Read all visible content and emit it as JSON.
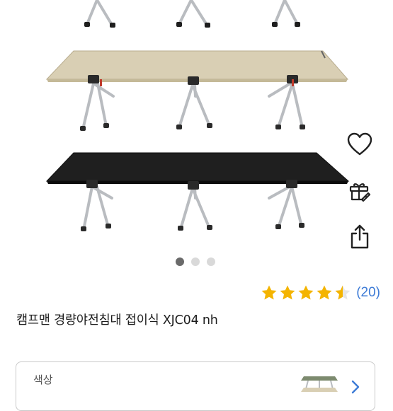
{
  "gallery": {
    "slide_count": 3,
    "active_slide": 1,
    "cot_colors": {
      "tan": "#d9cfb4",
      "black": "#1f1f1f",
      "frame": "#b9bcc0"
    }
  },
  "actions": {
    "wishlist_icon": "heart-icon",
    "gift_icon": "gift-icon",
    "share_icon": "share-icon"
  },
  "rating": {
    "stars": 4.5,
    "star_color": "#f4b400",
    "review_count": "(20)",
    "review_count_color": "#3d7bd6"
  },
  "product": {
    "title": "캠프맨 경량야전침대 접이식 XJC04 nh"
  },
  "option": {
    "label": "색상"
  }
}
